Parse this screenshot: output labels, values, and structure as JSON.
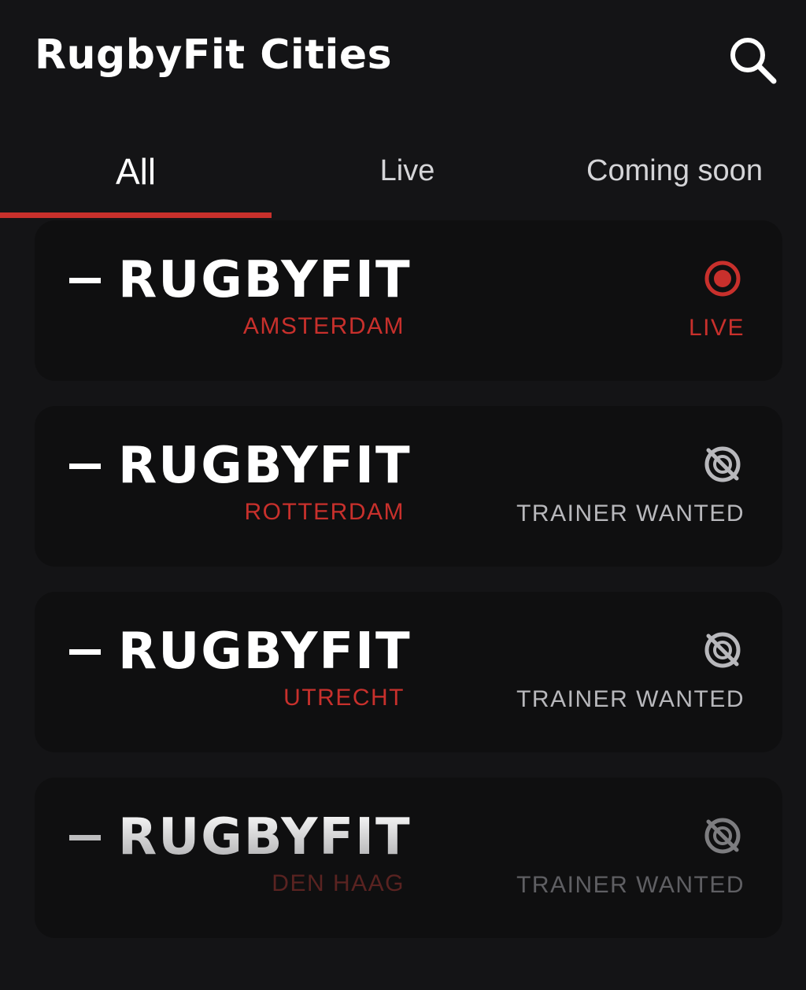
{
  "app": {
    "title": "RugbyFit Cities"
  },
  "header": {
    "search_icon": "search-icon"
  },
  "tabs": [
    {
      "label": "All",
      "active": true
    },
    {
      "label": "Live",
      "active": false
    },
    {
      "label": "Coming soon",
      "active": false
    }
  ],
  "cities": [
    {
      "brand": "RUGBYFIT",
      "city": "AMSTERDAM",
      "status": "LIVE",
      "status_icon": "live-record-icon"
    },
    {
      "brand": "RUGBYFIT",
      "city": "ROTTERDAM",
      "status": "TRAINER WANTED",
      "status_icon": "no-video-icon"
    },
    {
      "brand": "RUGBYFIT",
      "city": "UTRECHT",
      "status": "TRAINER WANTED",
      "status_icon": "no-video-icon"
    },
    {
      "brand": "RUGBYFIT",
      "city": "DEN HAAG",
      "status": "TRAINER WANTED",
      "status_icon": "no-video-icon"
    }
  ],
  "colors": {
    "background": "#141416",
    "card": "#0f0f10",
    "accent": "#c8302c",
    "muted": "#b8b8bc",
    "text": "#ffffff"
  }
}
